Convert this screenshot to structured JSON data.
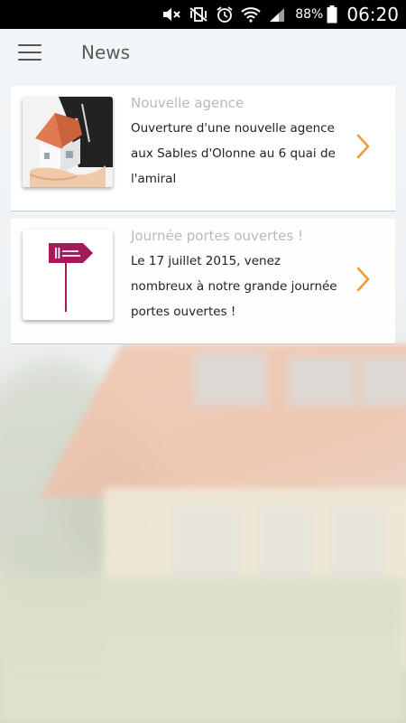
{
  "statusbar": {
    "battery_pct": "88%",
    "time": "06:20",
    "icons": [
      "mute-icon",
      "vibrate-icon",
      "alarm-icon",
      "wifi-icon",
      "signal-icon",
      "battery-icon"
    ]
  },
  "appbar": {
    "title": "News",
    "menu_icon": "hamburger-menu-icon"
  },
  "news": [
    {
      "title": "Nouvelle agence",
      "body": "Ouverture d'une nouvelle agence aux Sables d'Olonne au 6 quai de l'amiral",
      "thumbnail": "house-in-hand-image"
    },
    {
      "title": "Journée portes ouvertes !",
      "body": "Le 17 juillet 2015, venez nombreux à notre grande journée portes ouvertes !",
      "thumbnail": "agency-sign-logo-image"
    }
  ],
  "colors": {
    "accent": "#f39a3a",
    "title_gray": "#b9b9b9",
    "logo_magenta": "#a31b5a"
  }
}
